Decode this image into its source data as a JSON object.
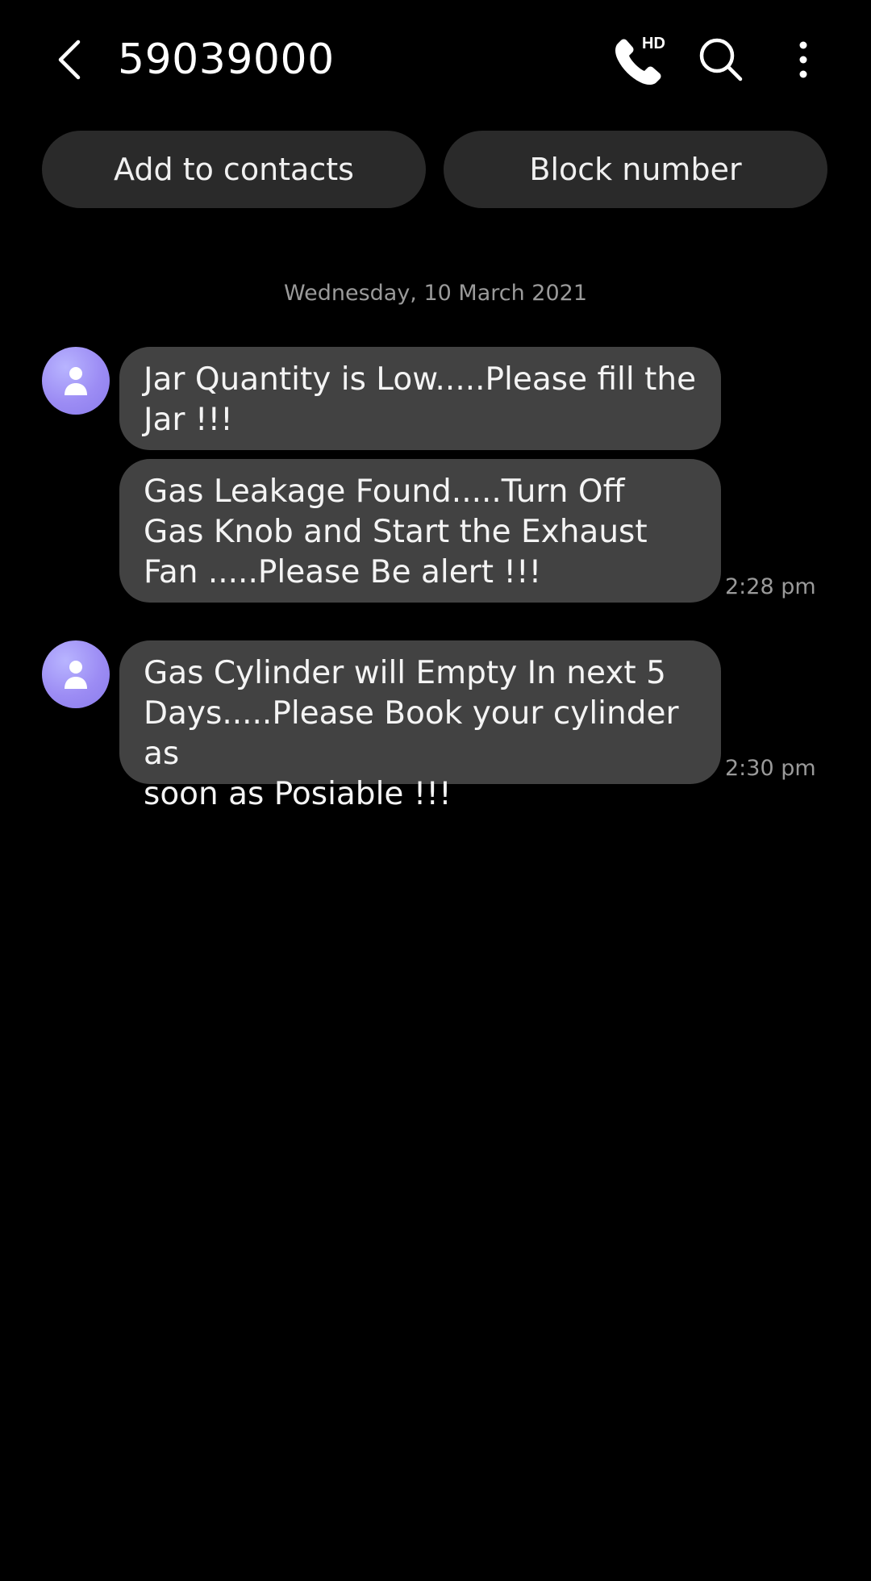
{
  "header": {
    "title": "59039000",
    "back_icon": "chevron-left-icon",
    "call_icon": "hd-call-icon",
    "call_badge": "HD",
    "search_icon": "search-icon",
    "more_icon": "more-vertical-icon"
  },
  "actions": {
    "add_contact_label": "Add to contacts",
    "block_label": "Block number"
  },
  "date_separator": "Wednesday, 10 March 2021",
  "messages": [
    {
      "text": "Jar Quantity is Low.....Please fill the\nJar !!!",
      "time": ""
    },
    {
      "text": "Gas Leakage Found.....Turn Off\nGas Knob and Start the Exhaust\nFan .....Please Be alert !!!",
      "time": "2:28 pm"
    },
    {
      "text": "Gas Cylinder will Empty In next 5\nDays.....Please Book your cylinder as\nsoon as Posiable !!!",
      "time": "2:30 pm"
    }
  ],
  "colors": {
    "background": "#000000",
    "bubble": "#424242",
    "pill": "#2a2a2a",
    "avatar": "#9c8cf4",
    "muted_text": "#9a9a9a"
  }
}
